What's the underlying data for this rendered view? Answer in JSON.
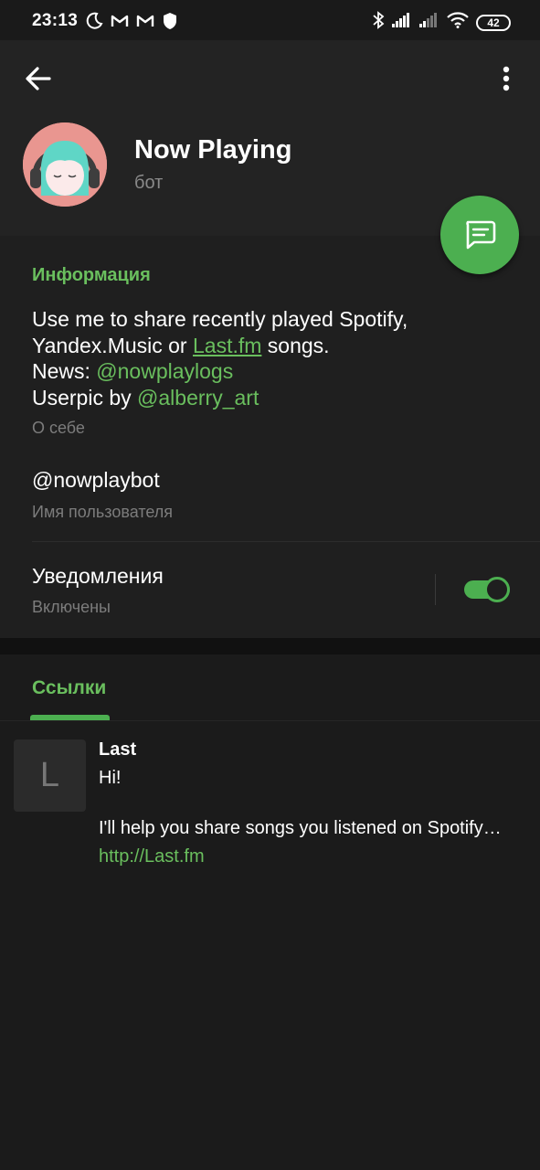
{
  "status_bar": {
    "time": "23:13",
    "battery": "42",
    "left_icons": [
      "moon-icon",
      "gmail-icon",
      "gmail-icon",
      "shield-icon"
    ],
    "right_icons": [
      "bluetooth-icon",
      "signal-icon",
      "signal-weak-icon",
      "wifi-icon",
      "battery-icon"
    ]
  },
  "header": {
    "back_icon": "arrow-left-icon",
    "menu_icon": "more-vertical-icon",
    "name": "Now Playing",
    "subtitle": "бот",
    "fab_icon": "message-icon"
  },
  "info": {
    "title": "Информация",
    "bio_line1": "Use me to share recently played Spotify,",
    "bio_line2_pre": "Yandex.Music or ",
    "bio_line2_link": "Last.fm",
    "bio_line2_post": " songs.",
    "bio_line3_pre": "News: ",
    "bio_line3_link": "@nowplaylogs",
    "bio_line4_pre": "Userpic by ",
    "bio_line4_link": "@alberry_art",
    "bio_caption": "О себе",
    "username": "@nowplaybot",
    "username_caption": "Имя пользователя",
    "notifications_title": "Уведомления",
    "notifications_status": "Включены",
    "notifications_enabled": true
  },
  "links_tab": {
    "label": "Ссылки"
  },
  "links": [
    {
      "thumb_letter": "L",
      "title": "Last",
      "desc_line1": "Hi!",
      "desc_line2": "I'll help you share songs you listened on Spotify…",
      "url": "http://Last.fm"
    }
  ],
  "colors": {
    "accent": "#4caf50",
    "accent_text": "#6abf5e",
    "background": "#1a1a1a",
    "header_bg": "#232323"
  }
}
